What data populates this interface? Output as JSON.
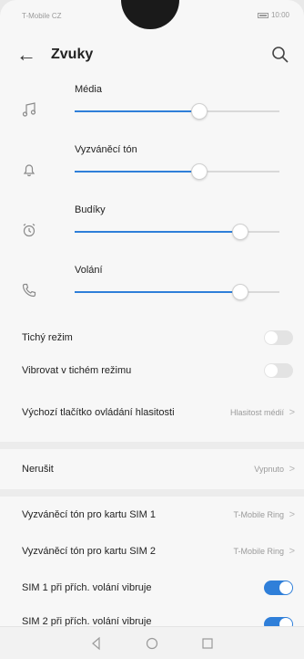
{
  "status_bar": {
    "carrier": "T-Mobile CZ",
    "time": "10:00"
  },
  "header": {
    "title": "Zvuky"
  },
  "volume": [
    {
      "label": "Média",
      "icon": "music-note-icon",
      "level": 0.61
    },
    {
      "label": "Vyzváněcí tón",
      "icon": "bell-icon",
      "level": 0.61
    },
    {
      "label": "Budíky",
      "icon": "alarm-clock-icon",
      "level": 0.81
    },
    {
      "label": "Volání",
      "icon": "phone-handset-icon",
      "level": 0.81
    }
  ],
  "settings": {
    "silent_mode": {
      "label": "Tichý režim",
      "enabled": false
    },
    "vibrate_silent": {
      "label": "Vibrovat v tichém režimu",
      "enabled": false
    },
    "volume_button": {
      "label": "Výchozí tlačítko ovládání hlasitosti",
      "value": "Hlasitost médií"
    },
    "dnd": {
      "label": "Nerušit",
      "value": "Vypnuto"
    },
    "ringtone_sim1": {
      "label": "Vyzváněcí tón pro kartu SIM 1",
      "value": "T-Mobile Ring"
    },
    "ringtone_sim2": {
      "label": "Vyzváněcí tón pro kartu SIM 2",
      "value": "T-Mobile Ring"
    },
    "vibrate_sim1": {
      "label": "SIM 1 při přích. volání vibruje",
      "enabled": true
    },
    "vibrate_sim2": {
      "label": "SIM 2 při přích. volání vibruje",
      "enabled": true
    }
  },
  "colors": {
    "accent": "#2f7fd9",
    "background": "#f7f7f7"
  }
}
